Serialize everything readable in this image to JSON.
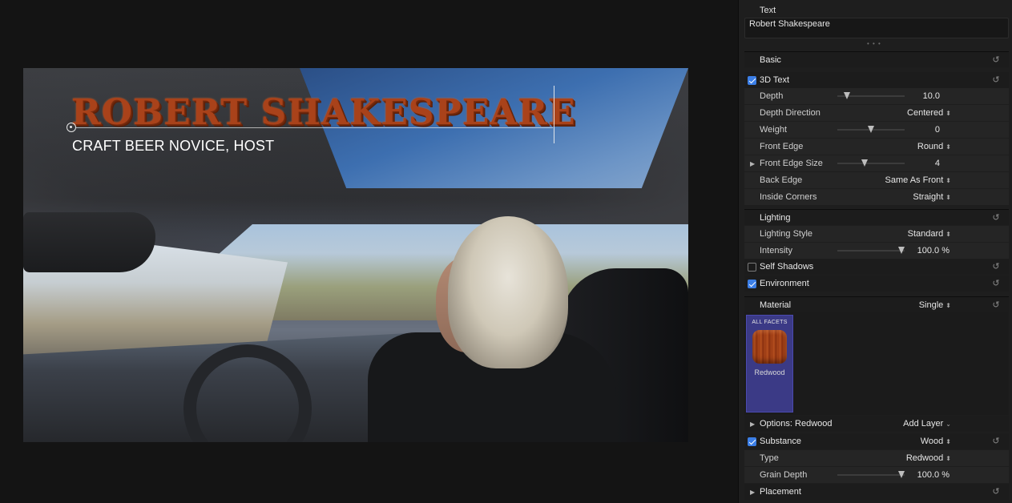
{
  "viewer": {
    "title_text": "ROBERT SHAKESPEARE",
    "subtitle_text": "CRAFT BEER NOVICE, HOST"
  },
  "inspector": {
    "text_section": {
      "label": "Text",
      "value": "Robert Shakespeare",
      "dots": "• • •"
    },
    "basic": {
      "label": "Basic"
    },
    "text3d": {
      "label": "3D Text",
      "checked": true
    },
    "depth": {
      "label": "Depth",
      "value": "10.0",
      "slider_fraction": 0.14
    },
    "depth_direction": {
      "label": "Depth Direction",
      "value": "Centered"
    },
    "weight": {
      "label": "Weight",
      "value": "0",
      "slider_fraction": 0.5
    },
    "front_edge": {
      "label": "Front Edge",
      "value": "Round"
    },
    "front_edge_size": {
      "label": "Front Edge Size",
      "value": "4",
      "slider_fraction": 0.4
    },
    "back_edge": {
      "label": "Back Edge",
      "value": "Same As Front"
    },
    "inside_corners": {
      "label": "Inside Corners",
      "value": "Straight"
    },
    "lighting": {
      "label": "Lighting"
    },
    "lighting_style": {
      "label": "Lighting Style",
      "value": "Standard"
    },
    "intensity": {
      "label": "Intensity",
      "value": "100.0",
      "unit": "%",
      "slider_fraction": 0.95
    },
    "self_shadows": {
      "label": "Self Shadows",
      "checked": false
    },
    "environment": {
      "label": "Environment",
      "checked": true
    },
    "material": {
      "label": "Material",
      "value": "Single"
    },
    "material_swatch": {
      "caption": "ALL FACETS",
      "name": "Redwood"
    },
    "options": {
      "label": "Options: Redwood",
      "add_layer": "Add Layer"
    },
    "substance": {
      "label": "Substance",
      "value": "Wood",
      "checked": true
    },
    "type": {
      "label": "Type",
      "value": "Redwood"
    },
    "grain_depth": {
      "label": "Grain Depth",
      "value": "100.0",
      "unit": "%",
      "slider_fraction": 0.95
    },
    "placement": {
      "label": "Placement"
    }
  },
  "icons": {
    "reset": "reset-arrow-icon",
    "disclosure": "disclosure-triangle-icon",
    "popup": "popup-arrows-icon",
    "checkbox": "checkbox-icon"
  },
  "colors": {
    "accent": "#3b7ee6",
    "title_wood": "#a9421a",
    "swatch_bg": "#3b3a86"
  }
}
